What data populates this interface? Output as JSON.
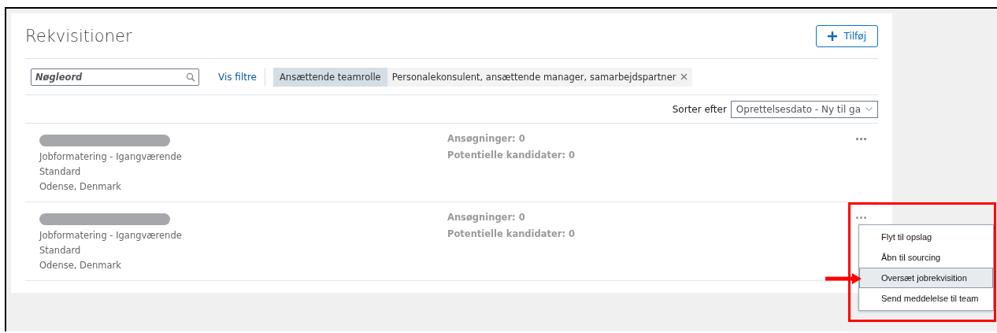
{
  "page": {
    "title": "Rekvisitioner",
    "add_button": "Tilføj"
  },
  "search": {
    "placeholder": "Nøgleord"
  },
  "show_filters": "Vis filtre",
  "filter_chip": {
    "label": "Ansættende teamrolle",
    "value": "Personalekonsulent, ansættende manager, samarbejdspartner"
  },
  "sort": {
    "label": "Sorter efter",
    "value": "Oprettelsesdato - Ny til ga"
  },
  "requisitions": [
    {
      "status": "Jobformatering - Igangværende",
      "template": "Standard",
      "location": "Odense, Denmark",
      "applications": "Ansøgninger: 0",
      "candidates": "Potentielle kandidater: 0",
      "menu_open": false
    },
    {
      "status": "Jobformatering - Igangværende",
      "template": "Standard",
      "location": "Odense, Denmark",
      "applications": "Ansøgninger: 0",
      "candidates": "Potentielle kandidater: 0",
      "menu_open": true
    }
  ],
  "context_menu": {
    "items": [
      {
        "label": "Flyt til opslag",
        "selected": false
      },
      {
        "label": "Åbn til sourcing",
        "selected": false
      },
      {
        "label": "Oversæt jobrekvisition",
        "selected": true
      },
      {
        "label": "Send meddelelse til team",
        "selected": false
      }
    ]
  }
}
